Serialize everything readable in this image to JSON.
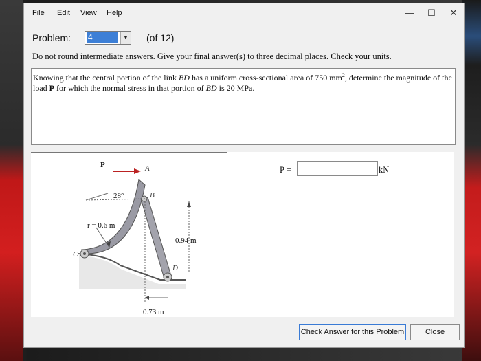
{
  "menu": {
    "file": "File",
    "edit": "Edit",
    "view": "View",
    "help": "Help"
  },
  "window_controls": {
    "minimize": "—",
    "maximize": "☐",
    "close": "✕"
  },
  "problem": {
    "label": "Problem:",
    "selected": "4",
    "of": "(of 12)"
  },
  "instruction": "Do not round intermediate answers. Give your final answer(s) to three decimal places. Check your units.",
  "statement": {
    "part1": "Knowing that the central portion of the link ",
    "bd1": "BD",
    "part2": " has a uniform cross-sectional area of 750 mm",
    "sup": "2",
    "part3": ", determine the magnitude of the load ",
    "p": "P",
    "part4": " for which the normal stress in that portion of ",
    "bd2": "BD",
    "part5": " is 20 MPa."
  },
  "figure": {
    "load_label": "P",
    "point_a": "A",
    "point_b": "B",
    "point_c": "C",
    "point_d": "D",
    "angle": "28°",
    "radius": "r = 0.6 m",
    "height": "0.94 m",
    "width": "0.73 m"
  },
  "answer": {
    "label": "P =",
    "value": "",
    "unit": "kN"
  },
  "buttons": {
    "check": "Check Answer for this Problem",
    "close": "Close"
  }
}
